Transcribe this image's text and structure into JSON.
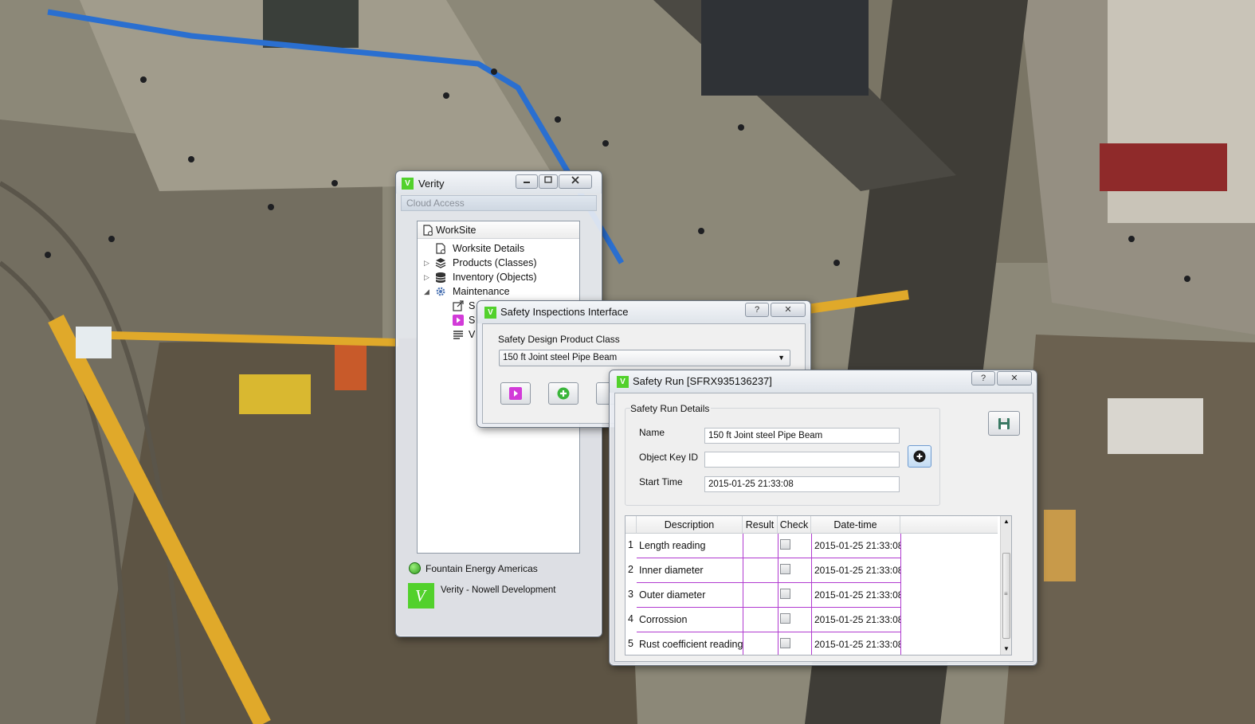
{
  "verity_window": {
    "title": "Verity",
    "app_icon_letter": "V",
    "menu_label": "Cloud Access",
    "tree": {
      "root": "WorkSite",
      "items": [
        {
          "label": "Worksite Details"
        },
        {
          "label": "Products (Classes)"
        },
        {
          "label": "Inventory (Objects)"
        },
        {
          "label": "Maintenance"
        }
      ],
      "maintenance_children": [
        "S",
        "S",
        "V"
      ]
    },
    "status": "Fountain Energy Americas",
    "footer_logo_letter": "V",
    "footer": "Verity - Nowell Development"
  },
  "inspections_window": {
    "title": "Safety Inspections Interface",
    "help_label": "?",
    "close_label": "✕",
    "product_class_label": "Safety Design Product Class",
    "product_class_value": "150 ft Joint steel Pipe Beam"
  },
  "safety_run_window": {
    "title": "Safety Run [SFRX935136237]",
    "help_label": "?",
    "close_label": "✕",
    "group_label": "Safety Run Details",
    "name_label": "Name",
    "name_value": "150 ft Joint steel Pipe Beam",
    "object_key_label": "Object Key ID",
    "object_key_value": "",
    "start_time_label": "Start Time",
    "start_time_value": "2015-01-25 21:33:08",
    "table": {
      "columns": [
        "Description",
        "Result",
        "Check",
        "Date-time"
      ],
      "rows": [
        {
          "num": "1",
          "description": "Length reading",
          "result": "",
          "checked": false,
          "datetime": "2015-01-25 21:33:08"
        },
        {
          "num": "2",
          "description": "Inner diameter",
          "result": "",
          "checked": false,
          "datetime": "2015-01-25 21:33:08"
        },
        {
          "num": "3",
          "description": "Outer diameter",
          "result": "",
          "checked": false,
          "datetime": "2015-01-25 21:33:08"
        },
        {
          "num": "4",
          "description": "Corrossion",
          "result": "",
          "checked": false,
          "datetime": "2015-01-25 21:33:08"
        },
        {
          "num": "5",
          "description": "Rust coefficient reading",
          "result": "",
          "checked": false,
          "datetime": "2015-01-25 21:33:08"
        }
      ]
    }
  },
  "colors": {
    "app_green": "#52d12c",
    "grid_magenta": "#b13bd0",
    "play_pink": "#d23bd8",
    "add_green": "#3ab53a"
  }
}
